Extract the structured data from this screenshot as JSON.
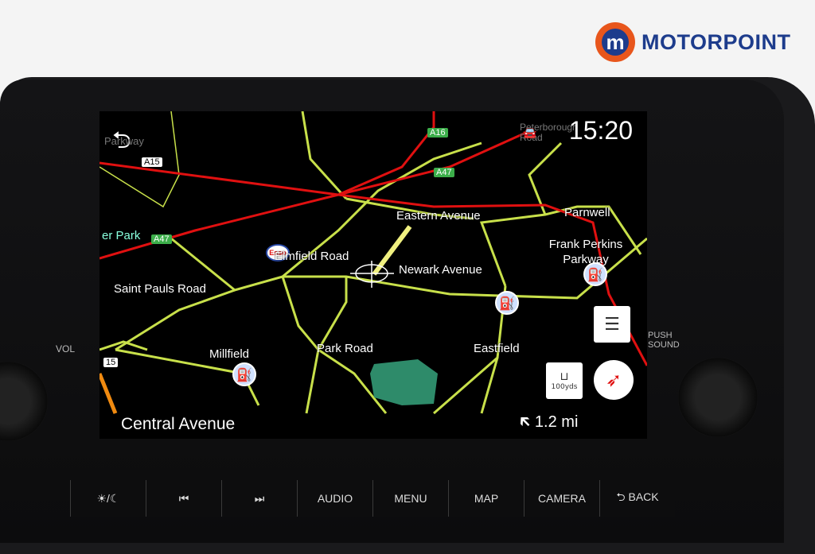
{
  "brand": {
    "name": "MOTORPOINT",
    "badge_letter": "m",
    "colors": {
      "orange": "#e8561c",
      "navy": "#1d3c8c"
    }
  },
  "map": {
    "time": "15:20",
    "distance": "1.2 mi",
    "current_street": "Central Avenue",
    "scale_label": "100yds",
    "road_shields": [
      "A15",
      "A16",
      "A47",
      "A47",
      "15"
    ],
    "place_labels": [
      "Parkway",
      "Peterborough Road",
      "er Park",
      "Elmfield Road",
      "Newark Avenue",
      "Eastern Avenue",
      "Parnwell",
      "Frank Perkins Parkway",
      "Saint Pauls Road",
      "Millfield",
      "Park Road",
      "Eastfield"
    ],
    "poi": {
      "esso": "Esso",
      "fuel_icon": "fuel-pump-icon"
    },
    "colors": {
      "major_road": "#e01010",
      "minor_road": "#c8e04a",
      "route": "#f0f080",
      "park": "#2e8b6a"
    }
  },
  "screen_buttons": {
    "back_icon": "back-arrow-icon",
    "menu_icon": "list-icon",
    "compass_icon": "compass-icon"
  },
  "hard_buttons": [
    "☀/☾",
    "⏮",
    "⏭",
    "AUDIO",
    "MENU",
    "MAP",
    "CAMERA",
    "⮌ BACK"
  ],
  "side_labels": {
    "vol": "VOL",
    "push_sound": "PUSH\nSOUND"
  }
}
